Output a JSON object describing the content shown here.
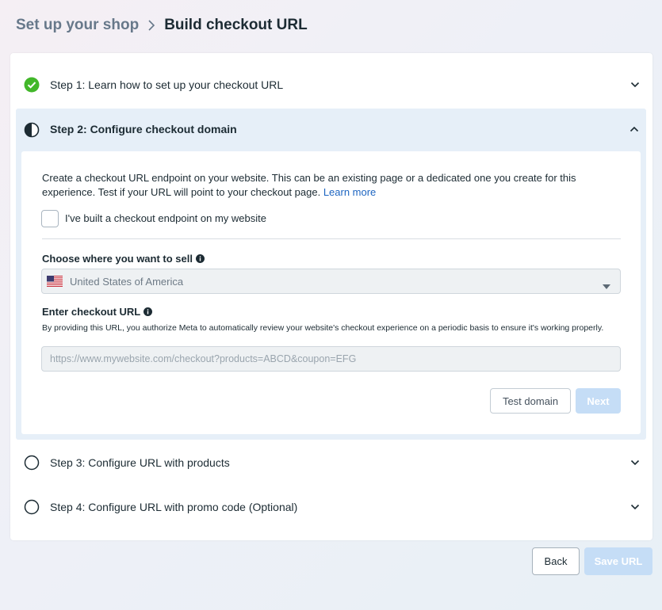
{
  "breadcrumb": {
    "parent": "Set up your shop",
    "current": "Build checkout URL"
  },
  "steps": [
    {
      "label": "Step 1: Learn how to set up your checkout URL",
      "status": "complete",
      "icon": "check-circle-icon"
    },
    {
      "label": "Step 2: Configure checkout domain",
      "status": "in-progress",
      "icon": "half-circle-icon"
    },
    {
      "label": "Step 3: Configure URL with products",
      "status": "not-started",
      "icon": "empty-circle-icon"
    },
    {
      "label": "Step 4: Configure URL with promo code (Optional)",
      "status": "not-started",
      "icon": "empty-circle-icon"
    }
  ],
  "step2": {
    "description": "Create a checkout URL endpoint on your website. This can be an existing page or a dedicated one you create for this experience. Test if your URL will point to your checkout page.",
    "learn_more": "Learn more",
    "checkbox_label": "I've built a checkout endpoint on my website",
    "checkbox_checked": false,
    "sell_label": "Choose where you want to sell",
    "sell_value": "United States of America",
    "url_label": "Enter checkout URL",
    "url_help": "By providing this URL, you authorize Meta to automatically review your website's checkout experience on a periodic basis to ensure it's working properly.",
    "url_placeholder": "https://www.mywebsite.com/checkout?products=ABCD&coupon=EFG",
    "url_value": "",
    "test_button": "Test domain",
    "next_button": "Next"
  },
  "footer": {
    "back_button": "Back",
    "save_button": "Save URL"
  },
  "colors": {
    "complete_green": "#42b72a",
    "link_blue": "#1d65c1",
    "disabled_primary": "#c5ddf6",
    "active_step_bg": "#e6eff8"
  }
}
